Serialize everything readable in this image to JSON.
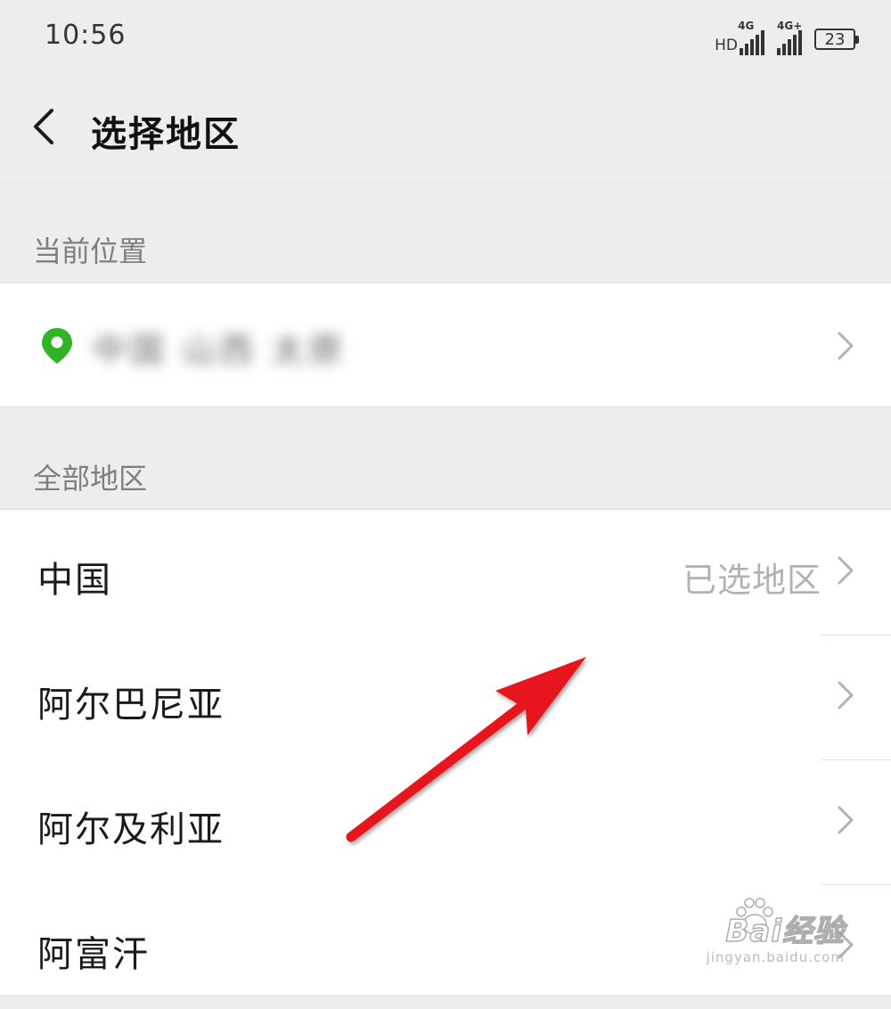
{
  "status_bar": {
    "time": "10:56",
    "network_hd": "HD",
    "network_1": "4G",
    "network_2": "4G+",
    "battery": "23"
  },
  "header": {
    "title": "选择地区",
    "back_icon": "chevron-left-icon"
  },
  "sections": {
    "current_location": {
      "label": "当前位置",
      "value": "中国 山西 太原",
      "icon": "location-pin-icon",
      "icon_color": "#2fb524"
    },
    "all_regions": {
      "label": "全部地区",
      "items": [
        {
          "name": "中国",
          "status": "已选地区"
        },
        {
          "name": "阿尔巴尼亚",
          "status": ""
        },
        {
          "name": "阿尔及利亚",
          "status": ""
        },
        {
          "name": "阿富汗",
          "status": ""
        }
      ]
    }
  },
  "annotation": {
    "arrow_color": "#e8141b"
  },
  "watermark": {
    "brand": "Bai经验",
    "paw_text": "du",
    "url": "jingyan.baidu.com"
  }
}
